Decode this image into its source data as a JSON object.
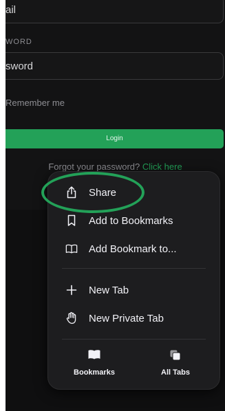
{
  "login": {
    "email_value": "ail",
    "password_label": "WORD",
    "password_value": "sword",
    "remember_label": "Remember me",
    "login_button": "Login",
    "forgot_text": "Forgot your password?",
    "forgot_link": "Click here"
  },
  "menu": {
    "items": [
      {
        "label": "Share",
        "icon": "share-icon"
      },
      {
        "label": "Add to Bookmarks",
        "icon": "bookmark-icon"
      },
      {
        "label": "Add Bookmark to...",
        "icon": "book-icon"
      },
      {
        "label": "New Tab",
        "icon": "plus-icon"
      },
      {
        "label": "New Private Tab",
        "icon": "hand-icon"
      }
    ],
    "bottom": [
      {
        "label": "Bookmarks",
        "icon": "bookmarks-icon"
      },
      {
        "label": "All Tabs",
        "icon": "tabs-icon"
      }
    ]
  },
  "colors": {
    "accent": "#23a158",
    "background": "#0f0f10",
    "menu_bg": "#1d1d1f"
  }
}
